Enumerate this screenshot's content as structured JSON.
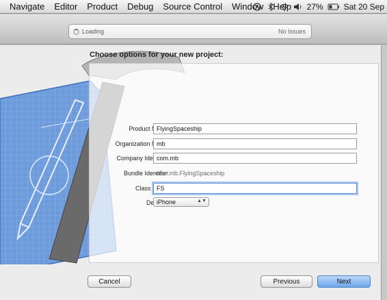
{
  "menubar": {
    "items": [
      "Navigate",
      "Editor",
      "Product",
      "Debug",
      "Source Control",
      "Window",
      "Help"
    ],
    "battery": "27%",
    "date": "Sat 20 Sep"
  },
  "toolbar": {
    "status": "Loading",
    "issues": "No Issues"
  },
  "sheet": {
    "title": "Choose options for your new project:",
    "fields": {
      "product_name": {
        "label": "Product Name",
        "value": "FlyingSpaceship"
      },
      "organization_name": {
        "label": "Organization Name",
        "value": "mb"
      },
      "company_identifier": {
        "label": "Company Identifier",
        "value": "com.mb"
      },
      "bundle_identifier": {
        "label": "Bundle Identifier",
        "value": "com.mb.FlyingSpaceship"
      },
      "class_prefix": {
        "label": "Class Prefix",
        "value": "FS"
      },
      "devices": {
        "label": "Devices",
        "value": "iPhone"
      }
    },
    "buttons": {
      "cancel": "Cancel",
      "previous": "Previous",
      "next": "Next"
    }
  }
}
